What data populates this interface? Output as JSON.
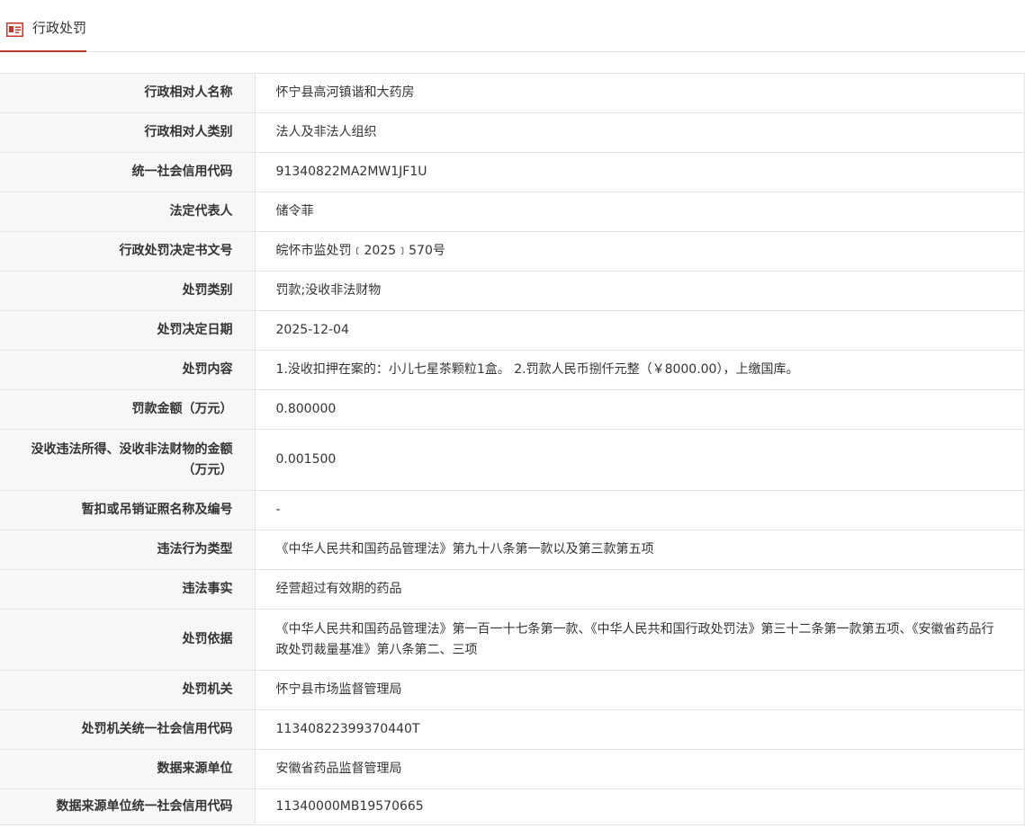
{
  "tab": {
    "label": "行政处罚",
    "icon": "id-card-icon",
    "accent_color": "#c0392b"
  },
  "rows": [
    {
      "label": "行政相对人名称",
      "value": "怀宁县高河镇谐和大药房"
    },
    {
      "label": "行政相对人类别",
      "value": "法人及非法人组织"
    },
    {
      "label": "统一社会信用代码",
      "value": "91340822MA2MW1JF1U"
    },
    {
      "label": "法定代表人",
      "value": "储令菲"
    },
    {
      "label": "行政处罚决定书文号",
      "value": "皖怀市监处罚﹝2025﹞570号"
    },
    {
      "label": "处罚类别",
      "value": "罚款;没收非法财物"
    },
    {
      "label": "处罚决定日期",
      "value": "2025-12-04"
    },
    {
      "label": "处罚内容",
      "value": "1.没收扣押在案的：小儿七星茶颗粒1盒。 2.罚款人民币捌仟元整（￥8000.00），上缴国库。"
    },
    {
      "label": "罚款金额（万元）",
      "value": "0.800000"
    },
    {
      "label": "没收违法所得、没收非法财物的金额（万元）",
      "value": "0.001500"
    },
    {
      "label": "暂扣或吊销证照名称及编号",
      "value": "-"
    },
    {
      "label": "违法行为类型",
      "value": "《中华人民共和国药品管理法》第九十八条第一款以及第三款第五项"
    },
    {
      "label": "违法事实",
      "value": "经营超过有效期的药品"
    },
    {
      "label": "处罚依据",
      "value": "《中华人民共和国药品管理法》第一百一十七条第一款、《中华人民共和国行政处罚法》第三十二条第一款第五项、《安徽省药品行政处罚裁量基准》第八条第二、三项"
    },
    {
      "label": "处罚机关",
      "value": "怀宁县市场监督管理局"
    },
    {
      "label": "处罚机关统一社会信用代码",
      "value": "11340822399370440T"
    },
    {
      "label": "数据来源单位",
      "value": "安徽省药品监督管理局"
    },
    {
      "label": "数据来源单位统一社会信用代码",
      "value": "11340000MB19570665"
    }
  ]
}
